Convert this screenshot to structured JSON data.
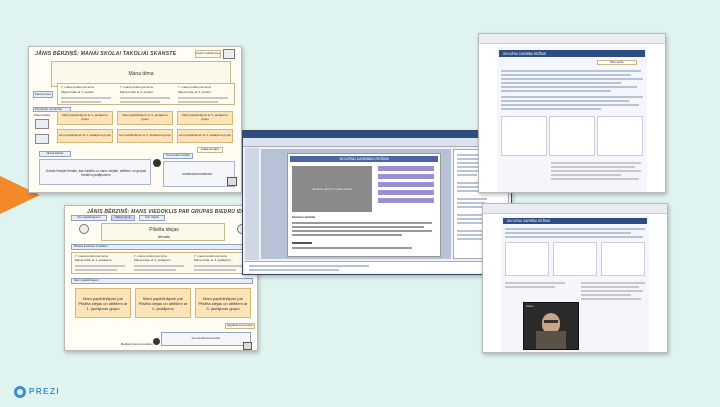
{
  "brand": {
    "name": "PREZI",
    "accent": "#3b8fd0"
  },
  "colors": {
    "background": "#dff3f0",
    "tab": "#f4892a",
    "window_bar": "#2c4e83"
  },
  "slide1": {
    "title": "JĀNIS BĒRZIŅŠ: MANAI SKOLAI TAKOLIAI SKANSTE",
    "header_btn": "Paņemt mācību tēmu",
    "main_box": "Mana tēma",
    "side_label": "Mana izvēle",
    "list_cells": [
      "7. mana punktu par tēmu",
      "Mana izvēle ar 1. punktu",
      "7. mana punktu par tēmu",
      "Mana izvēle ar 2. punktu",
      "7. mana punktu par tēmu",
      "Mana izvēle ar 3. punktu"
    ],
    "section_label": "Pievērsiet uzmanību",
    "left_small": "Pāriet attēla",
    "peach_top": [
      "Mani papildinājumi ar 1. jautājuma grupu",
      "Mani papildinājumi ar 2. jautājuma grupu",
      "Mani papildinājumi ar 3. jautājuma grupu"
    ],
    "peach_bottom": [
      "Ievi papildinājumi ar 1. jautājuma grupu",
      "Ievi papildinājumi ar 2. jautājuma grupu",
      "Ievi papildinājumi ar 3. jautājuma grupu"
    ],
    "next_btn": "Nākamā lapa",
    "bottom_left_btn": "Mana kartīte",
    "question": "Dzīvās lietojiet tēmām, kas balstīts uz manu idejām, attēliem un grupas kreatīvu jautājumiem",
    "comment_btn": "Komentāru kartīte",
    "comment_text": "Komentāra komentāri"
  },
  "slide2": {
    "title": "JĀNIS BĒRZIŅŠ: MANS VIEDOKLIS PAR GRUPAS BIEDRU IDEJĀM",
    "tabs": [
      "Šis papildinājums",
      "Mana tēma",
      "Citu idejas"
    ],
    "center_title_1": "Pilsēta idejas",
    "center_title_2": "tēmats",
    "section_1": "Pilsēta ilustrāta vizuāliem",
    "list_cells": [
      "7. mana punktu par tēmu",
      "Mana izvēle ar 1. jautājumu",
      "7. mana punktu par tēmu",
      "Mana izvēle ar 2. jautājumu",
      "7. mana punktu par tēmu",
      "Mana izvēle ar 3. jautājumu"
    ],
    "section_2": "Mani papildinājumi",
    "peach": [
      "Mani papildinājumi par Pilsēta idejas un attēliem ar 1. jautājumu grupu",
      "Mani papildinājumi par Pilsēta idejas un attēliem ar 2. jautājumu",
      "Mani papildinājumi par Pilsēta idejas un attēliem ar 3. jautājumu grupu"
    ],
    "bottom_btn": "Saglabāt komentāru",
    "bottom_left": "Rediģēt jūsu komentāru",
    "comment_text": "Komentāra komentāri"
  },
  "center_window": {
    "doc_title": "SKOLĒNU DARBĪBAS REŽĪMĀ",
    "image_caption": "Skolēnu darbu iz krāsu teksta",
    "subhead": "Skolēnu darbība",
    "menu_items": [
      "Darbība 1",
      "Darbība 2",
      "Darbība 3",
      "Darbība 4",
      "Darbība 5"
    ]
  },
  "browser_top": {
    "heading": "SKOLĒNU DARBĪBA REŽĪMĀ",
    "button": "Sākt darbu"
  },
  "browser_bottom": {
    "heading": "SKOLĒNU DARBĪBA REŽĪMĀ",
    "video_label": "Video"
  }
}
